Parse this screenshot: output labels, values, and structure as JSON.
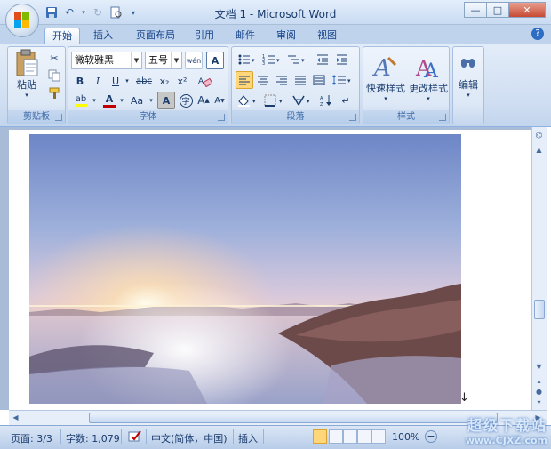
{
  "window": {
    "title": "文档 1 - Microsoft Word",
    "controls": {
      "minimize": "—",
      "maximize": "□",
      "close": "✕"
    }
  },
  "qat": [
    "save-icon",
    "undo-icon",
    "redo-icon",
    "print-preview-icon",
    "customize-icon"
  ],
  "tabs": [
    {
      "label": "开始",
      "active": true
    },
    {
      "label": "插入"
    },
    {
      "label": "页面布局"
    },
    {
      "label": "引用"
    },
    {
      "label": "邮件"
    },
    {
      "label": "审阅"
    },
    {
      "label": "视图"
    }
  ],
  "ribbon": {
    "clipboard": {
      "paste_label": "粘贴",
      "group_label": "剪贴板"
    },
    "font": {
      "font_name": "微软雅黑",
      "font_size": "五号",
      "phonetic": "wén",
      "border_char": "A",
      "bold": "B",
      "italic": "I",
      "underline": "U",
      "strike": "abc",
      "subscript": "x₂",
      "superscript": "x²",
      "highlight": "ab",
      "font_color": "A",
      "case": "Aa",
      "shading_char": "A",
      "enclose_char": "字",
      "grow": "A",
      "shrink": "A",
      "group_label": "字体"
    },
    "paragraph": {
      "group_label": "段落"
    },
    "styles": {
      "quick_label": "快速样式",
      "change_label": "更改样式",
      "group_label": "样式"
    },
    "editing": {
      "label": "编辑"
    }
  },
  "status": {
    "page": "页面: 3/3",
    "words": "字数: 1,079",
    "language": "中文(简体，中国)",
    "mode": "插入",
    "zoom": "100%"
  },
  "watermark": {
    "line1": "超级下载站",
    "line2": "www.CJXZ.com"
  },
  "colors": {
    "ribbon_blue": "#d0def2",
    "font_color_red": "#c00000",
    "highlight_yellow": "#ffff00"
  }
}
